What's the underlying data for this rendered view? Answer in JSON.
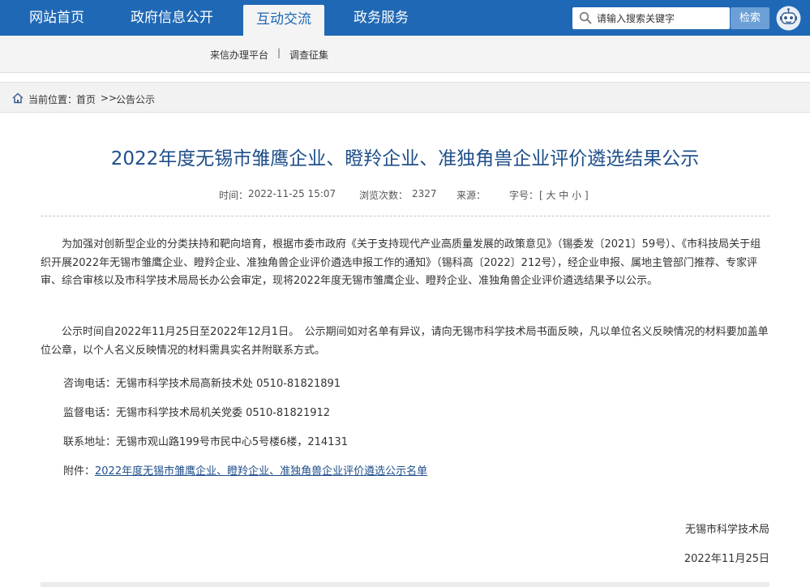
{
  "nav": {
    "items": [
      {
        "label": "网站首页"
      },
      {
        "label": "政府信息公开"
      },
      {
        "label": "互动交流"
      },
      {
        "label": "政务服务"
      }
    ],
    "active_index": 2
  },
  "search": {
    "placeholder": "请输入搜索关键字",
    "button_label": "检索"
  },
  "subnav": {
    "items": [
      {
        "label": "来信办理平台"
      },
      {
        "label": "调查征集"
      }
    ],
    "separator": "|"
  },
  "breadcrumb": {
    "prefix": "当前位置：",
    "home": "首页",
    "sep": ">>",
    "current": "公告公示"
  },
  "article": {
    "title": "2022年度无锡市雏鹰企业、瞪羚企业、准独角兽企业评价遴选结果公示",
    "meta": {
      "time_label": "时间：",
      "time_value": "2022-11-25 15:07",
      "views_label": "浏览次数：",
      "views_value": "2327",
      "source_label": "来源：",
      "font_label": "字号：",
      "font_options": "[ 大 中 小 ]"
    },
    "para1": "为加强对创新型企业的分类扶持和靶向培育，根据市委市政府《关于支持现代产业高质量发展的政策意见》（锡委发〔2021〕59号）、《市科技局关于组织开展2022年无锡市雏鹰企业、瞪羚企业、准独角兽企业评价遴选申报工作的通知》（锡科高〔2022〕212号），经企业申报、属地主管部门推荐、专家评审、综合审核以及市科学技术局局长办公会审定，现将2022年度无锡市雏鹰企业、瞪羚企业、准独角兽企业评价遴选结果予以公示。",
    "para2": "公示时间自2022年11月25日至2022年12月1日。　公示期间如对名单有异议，请向无锡市科学技术局书面反映，凡以单位名义反映情况的材料要加盖单位公章，以个人名义反映情况的材料需具实名并附联系方式。",
    "consult": "咨询电话：无锡市科学技术局高新技术处 0510-81821891",
    "supervise": "监督电话：无锡市科学技术局机关党委 0510-81821912",
    "address": "联系地址：无锡市观山路199号市民中心5号楼6楼，214131",
    "attachment_label": "附件：",
    "attachment_link": "2022年度无锡市雏鹰企业、瞪羚企业、准独角兽企业评价遴选公示名单",
    "signer": "无锡市科学技术局",
    "date": "2022年11月25日"
  },
  "colors": {
    "nav_blue": "#1f68b5",
    "title_blue": "#1f4f8a",
    "search_button": "#6b9fd6"
  },
  "icons": [
    "search-icon",
    "robot-icon",
    "home-icon"
  ]
}
